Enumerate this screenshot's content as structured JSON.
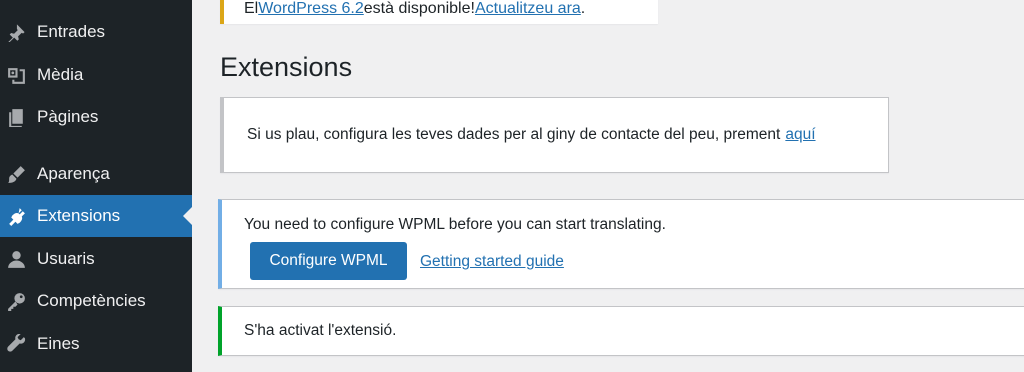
{
  "sidebar": {
    "items": [
      {
        "label": "Entrades",
        "icon": "pin-icon"
      },
      {
        "label": "Mèdia",
        "icon": "media-icon"
      },
      {
        "label": "Pàgines",
        "icon": "pages-icon"
      },
      {
        "label": "Aparença",
        "icon": "brush-icon"
      },
      {
        "label": "Extensions",
        "icon": "plugin-icon",
        "active": true
      },
      {
        "label": "Usuaris",
        "icon": "user-icon"
      },
      {
        "label": "Competències",
        "icon": "key-icon"
      },
      {
        "label": "Eines",
        "icon": "wrench-icon"
      }
    ],
    "active_color": "#2271b1",
    "background": "#1d2327"
  },
  "update_nag": {
    "prefix": "El ",
    "link1": "WordPress 6.2",
    "middle": " està disponible! ",
    "link2": "Actualitzeu ara",
    "suffix": "."
  },
  "page": {
    "title": "Extensions"
  },
  "notices": {
    "contact": {
      "text": "Si us plau, configura les teves dades per al giny de contacte del peu, prement",
      "link": "aquí"
    },
    "wpml": {
      "text": "You need to configure WPML before you can start translating.",
      "button": "Configure WPML",
      "link": "Getting started guide"
    },
    "success": {
      "text": "S'ha activat l'extensió."
    }
  }
}
